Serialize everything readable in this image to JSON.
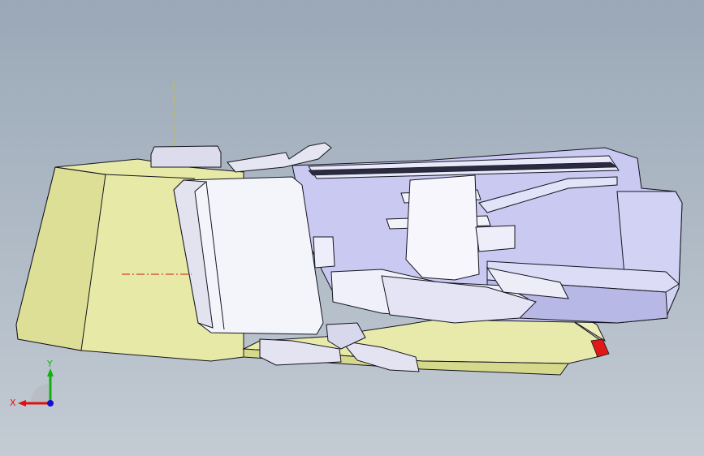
{
  "viewport": {
    "background_top": "#9aa8b7",
    "background_bottom": "#c3cbd3"
  },
  "model": {
    "colors": {
      "yellow_part": "#e7eaa6",
      "yellow_shade": "#d3d78a",
      "lavender_part": "#c9c9f2",
      "lavender_dark": "#a9a9dc",
      "white_part": "#f4f4fb",
      "edge": "#15151f",
      "centerline": "#d01010",
      "highlight_red": "#e01818"
    }
  },
  "triad": {
    "x_label": "X",
    "y_label": "Y",
    "x_color": "#e01010",
    "y_color": "#10b010",
    "z_color": "#1010d0",
    "icon": "coordinate-triad-icon"
  }
}
